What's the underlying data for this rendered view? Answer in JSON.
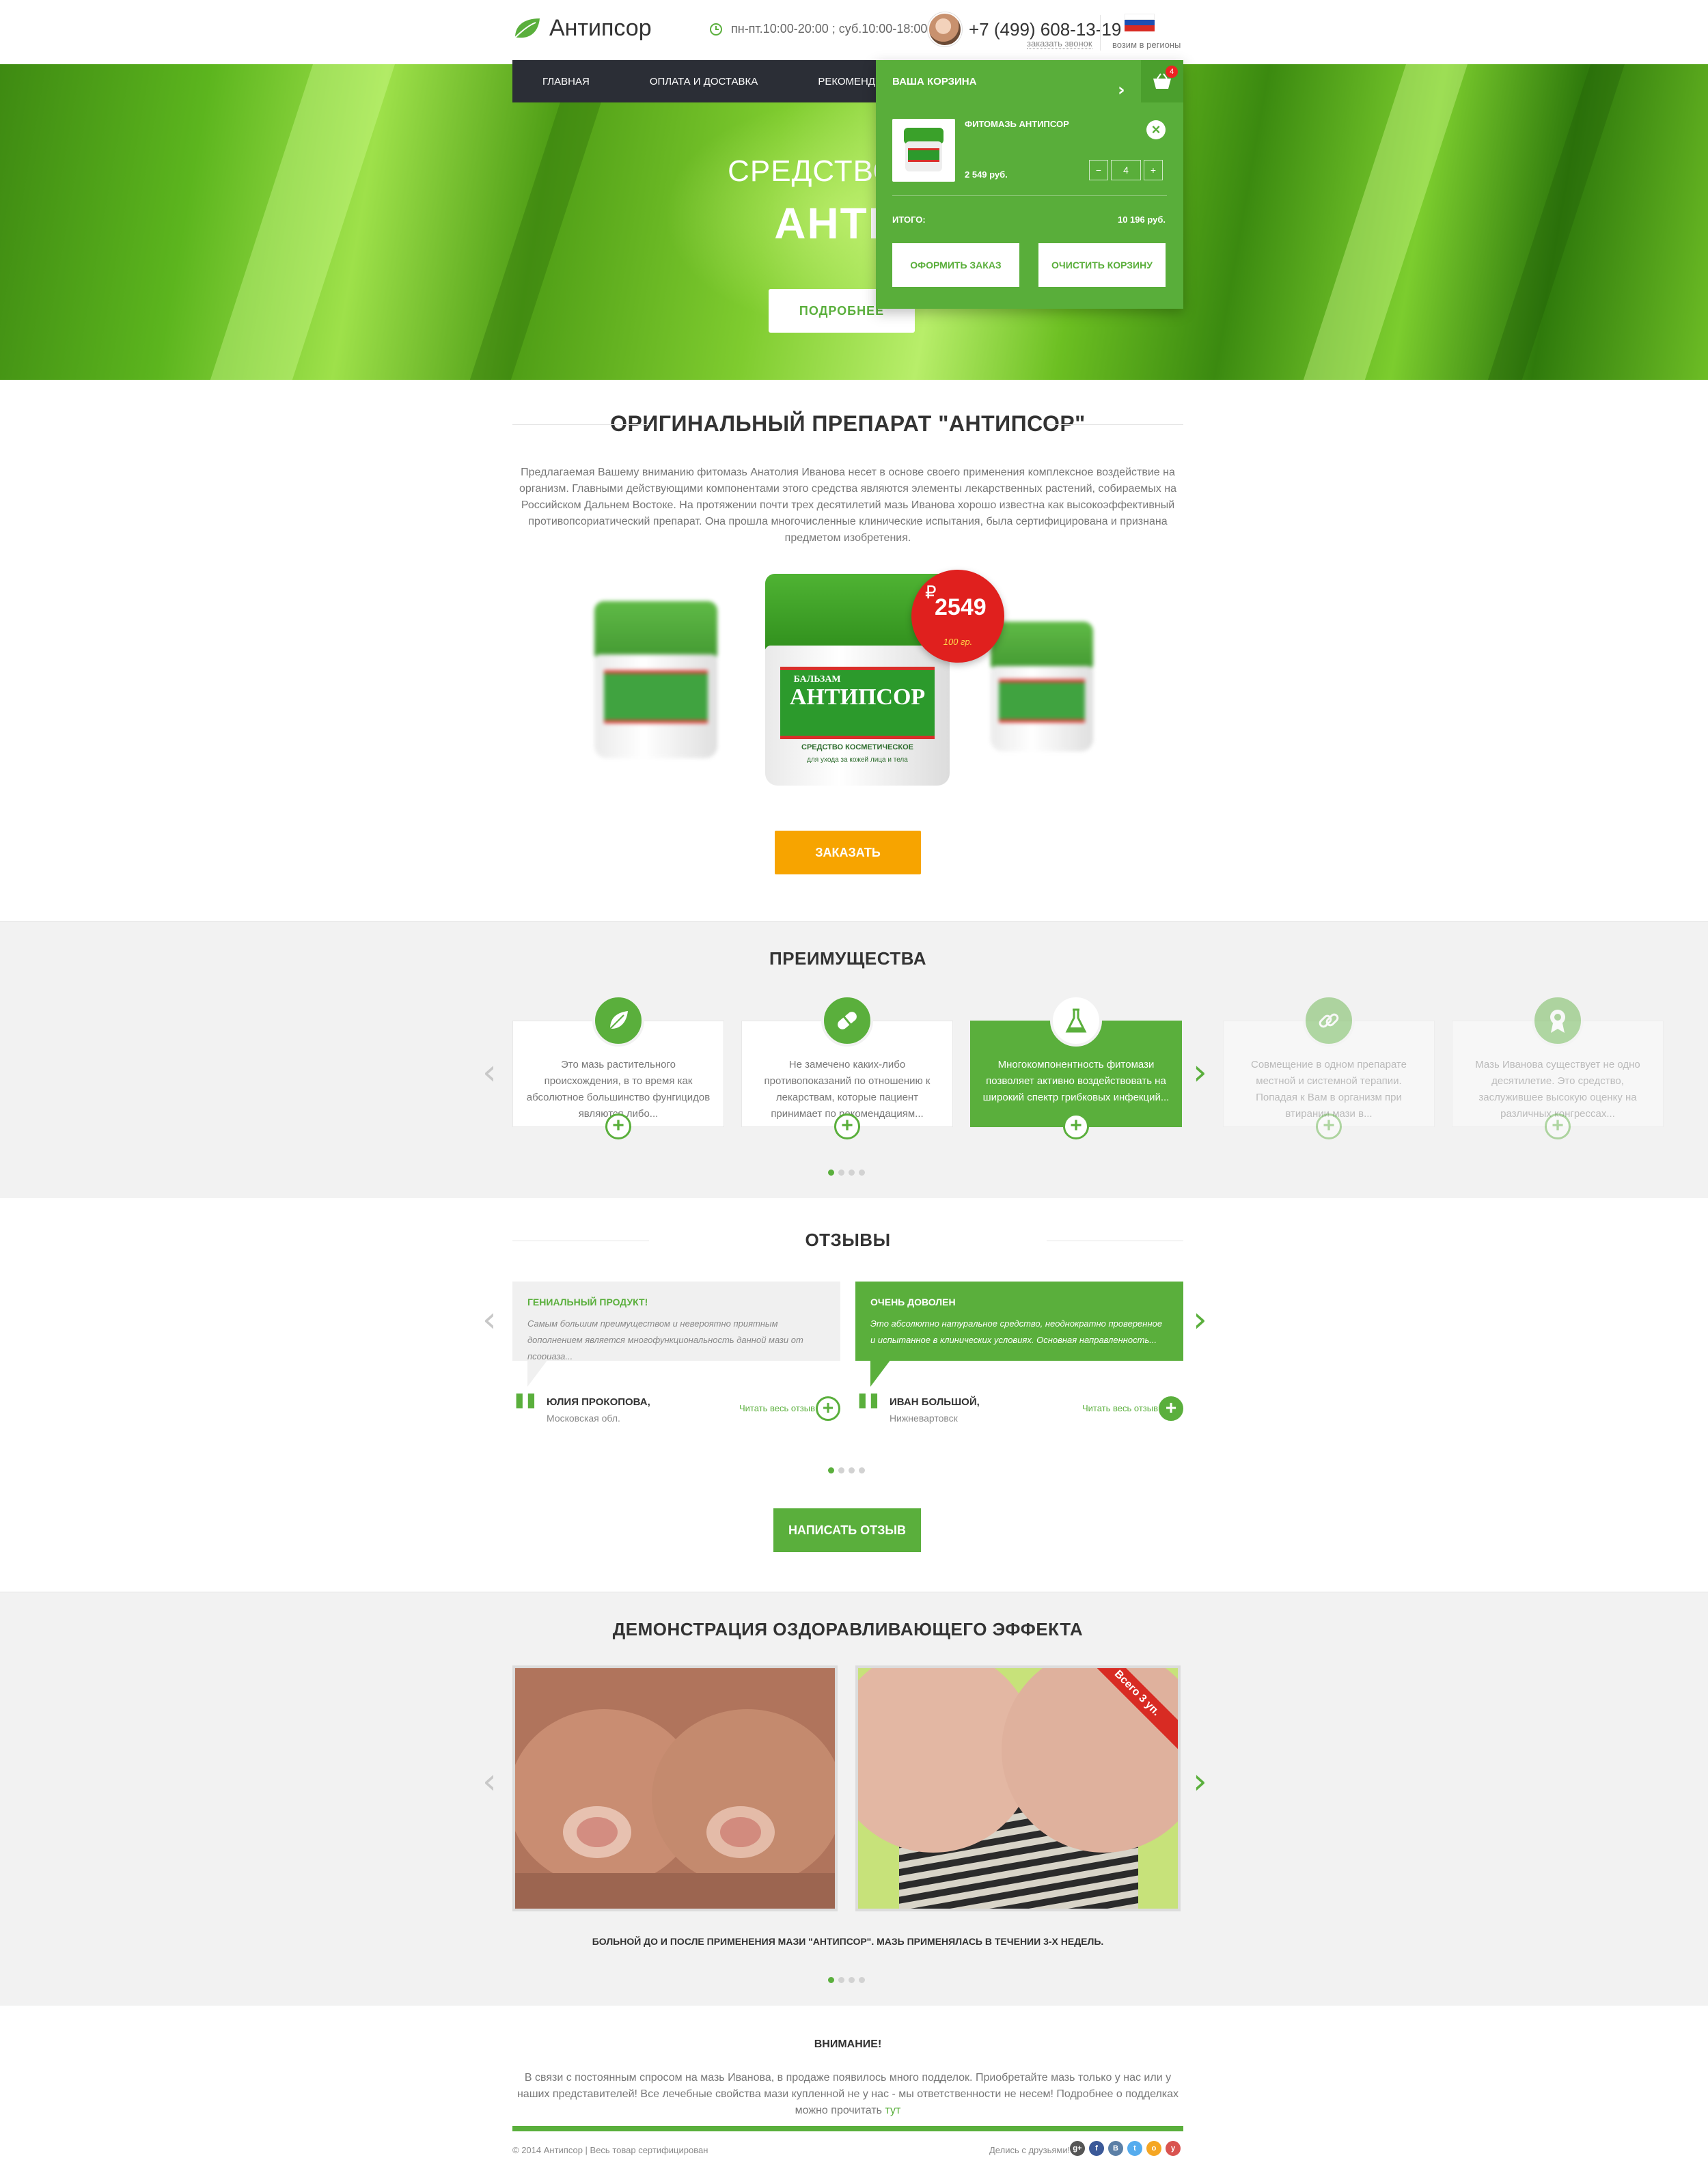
{
  "header": {
    "logo": "Антипсор",
    "hours": "пн-пт.10:00-20:00  ;  суб.10:00-18:00",
    "phone": "+7 (499) 608-13-19",
    "callback": "заказать звонок",
    "region": "возим в регионы"
  },
  "nav": {
    "items": [
      "Главная",
      "Оплата и доставка",
      "Рекомендуем аптекам"
    ]
  },
  "cart": {
    "title": "Ваша корзина",
    "badge": "4",
    "product_name": "Фитомазь Антипсор",
    "product_price": "2 549 руб.",
    "qty_minus": "−",
    "qty_value": "4",
    "qty_plus": "+",
    "total_label": "Итого:",
    "total_value": "10 196 руб.",
    "checkout": "Оформить заказ",
    "clear": "Очистить корзину"
  },
  "hero": {
    "title_line1": "СРЕДСТВО ОТ П",
    "title_line2": "АНТИП",
    "more": "ПОДРОБНЕЕ"
  },
  "intro": {
    "title": "ОРИГИНАЛЬНЫЙ ПРЕПАРАТ \"АНТИПСОР\"",
    "text": "Предлагаемая Вашему вниманию фитомазь Анатолия Иванова несет в основе своего применения комплексное воздействие на организм. Главными действующими компонентами этого средства являются элементы лекарственных растений, собираемых на Российском Дальнем Востоке. На протяжении почти трех десятилетий мазь Иванова хорошо известна как высокоэффективный противопсориатический препарат. Она прошла многочисленные клинические испытания, была сертифицирована и признана предметом изобретения."
  },
  "product": {
    "jar_small_top": "БАЛЬЗАМ",
    "jar_name": "АНТИПСОР",
    "jar_sub": "СРЕДСТВО КОСМЕТИЧЕСКОЕ",
    "jar_sub2": "для ухода за кожей лица и тела",
    "currency": "₽",
    "price": "2549",
    "weight": "100 гр.",
    "order": "ЗАКАЗАТЬ"
  },
  "advantages": {
    "title": "ПРЕИМУЩЕСТВА",
    "cards": [
      {
        "text": "Это мазь растительного происхождения, в то время как абсолютное большинство фунгицидов являются либо..."
      },
      {
        "text": "Не замечено каких-либо противопоказаний по отношению к лекарствам, которые пациент принимает по рекомендациям..."
      },
      {
        "text": "Многокомпонентность фитомази позволяет активно воздействовать на широкий спектр грибковых инфекций..."
      },
      {
        "text": "Совмещение в одном препарате местной и системной терапии. Попадая к Вам в организм при втирании мази в..."
      },
      {
        "text": "Мазь Иванова существует не одно десятилетие. Это средство, заслужившее высокую оценку на различных конгрессах..."
      }
    ],
    "plus": "+"
  },
  "reviews": {
    "title": "ОТЗЫВЫ",
    "items": [
      {
        "title": "Гениальный продукт!",
        "text": "Самым большим преимуществом и невероятно приятным дополнением является многофункциональность данной мази от псориаза...",
        "name": "Юлия Прокопова,",
        "city": "Московская обл.",
        "read": "Читать весь отзыв"
      },
      {
        "title": "Очень доволен",
        "text": "Это абсолютно натуральное средство, неоднократно проверенное и испытанное в клинических условиях. Основная направленность...",
        "name": "Иван Большой,",
        "city": "Нижневартовск",
        "read": "Читать весь отзыв"
      }
    ],
    "write": "НАПИСАТЬ ОТЗЫВ",
    "plus": "+"
  },
  "demo": {
    "title": "ДЕМОНСТРАЦИЯ ОЗДОРАВЛИВАЮЩЕГО ЭФФЕКТА",
    "ribbon": "Всего 3 уп.",
    "caption": "БОЛЬНОЙ ДО И ПОСЛЕ ПРИМЕНЕНИЯ МАЗИ \"АНТИПСОР\". МАЗЬ ПРИМЕНЯЛАСЬ В ТЕЧЕНИИ 3-Х НЕДЕЛЬ."
  },
  "attention": {
    "title": "ВНИМАНИЕ!",
    "text": "В связи с постоянным спросом на мазь Иванова, в продаже появилось много подделок. Приобретайте мазь только у нас или у наших представителей! Все лечебные свойства мази купленной не у нас - мы ответственности не несем! Подробнее о подделках можно прочитать",
    "link": "тут"
  },
  "footer": {
    "copyright": "© 2014 Антипсор   |   Весь товар сертифицирован",
    "share": "Делись с друзьями!",
    "socials": [
      {
        "label": "g+",
        "color": "#555555"
      },
      {
        "label": "f",
        "color": "#3b5998"
      },
      {
        "label": "B",
        "color": "#5b7fa6"
      },
      {
        "label": "t",
        "color": "#55acee"
      },
      {
        "label": "o",
        "color": "#f5a623"
      },
      {
        "label": "y",
        "color": "#d9534f"
      }
    ]
  },
  "colors": {
    "accent": "#5aaf3c",
    "orange": "#f7a400",
    "red": "#e0201e",
    "dark": "#2b2e36"
  }
}
